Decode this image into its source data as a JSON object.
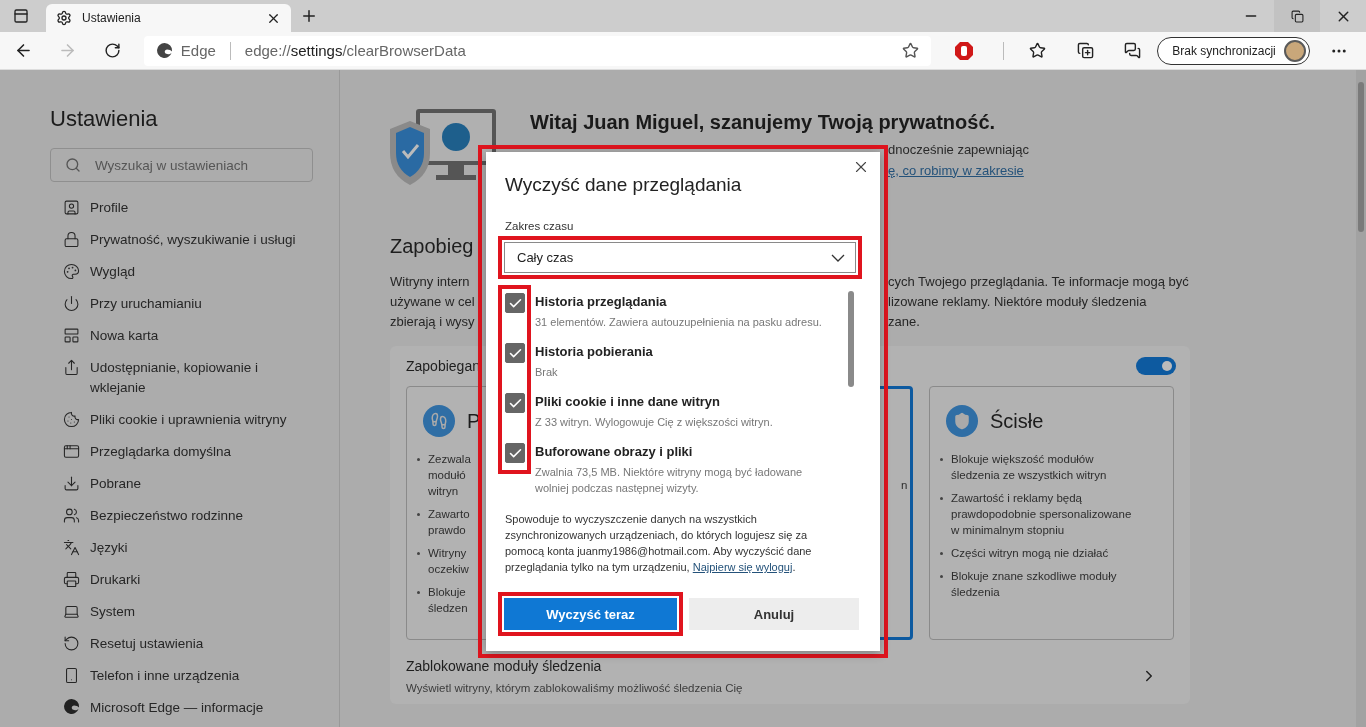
{
  "tabs": [
    {
      "label": "Ustawienia",
      "selected": true
    }
  ],
  "address_bar": {
    "site_label": "Edge",
    "url_prefix": "edge://",
    "url_host": "settings",
    "url_path": "/clearBrowserData"
  },
  "sync_button": {
    "label": "Brak synchronizacji"
  },
  "sidebar": {
    "title": "Ustawienia",
    "search": {
      "placeholder": "Wyszukaj w ustawieniach"
    },
    "items": [
      {
        "label": "Profile"
      },
      {
        "label": "Prywatność, wyszukiwanie i usługi"
      },
      {
        "label": "Wygląd"
      },
      {
        "label": "Przy uruchamianiu"
      },
      {
        "label": "Nowa karta"
      },
      {
        "label": "Udostępnianie, kopiowanie i wklejanie"
      },
      {
        "label": "Pliki cookie i uprawnienia witryny"
      },
      {
        "label": "Przeglądarka domyślna"
      },
      {
        "label": "Pobrane"
      },
      {
        "label": "Bezpieczeństwo rodzinne"
      },
      {
        "label": "Języki"
      },
      {
        "label": "Drukarki"
      },
      {
        "label": "System"
      },
      {
        "label": "Resetuj ustawienia"
      },
      {
        "label": "Telefon i inne urządzenia"
      },
      {
        "label": "Microsoft Edge — informacje"
      }
    ]
  },
  "privacy_header": {
    "title": "Witaj Juan Miguel, szanujemy Twoją prywatność.",
    "line_2": "dnocześnie zapewniając",
    "link": "ę, co robimy w zakresie"
  },
  "tracking_section": {
    "title": "Zapobieg",
    "text_left": [
      "Witryny intern",
      "używane w cel",
      "zbierają i wysy"
    ],
    "text_right": [
      "cych Twojego przeglądania. Te informacje mogą być",
      "lizowane reklamy. Niektóre moduły śledzenia",
      "zane."
    ],
    "card_title": "Zapobiegan",
    "toggle_on": true,
    "options": [
      {
        "title": "P",
        "selected": false,
        "bullets": [
          [
            "Zezwala",
            "modułó",
            "witryn"
          ],
          [
            "Zawarto",
            "prawdo"
          ],
          [
            "Witryny",
            "oczekiw"
          ],
          [
            "Blokuje",
            "śledzen"
          ]
        ]
      },
      {
        "selected": true,
        "bullets": [
          [
            "n"
          ]
        ]
      },
      {
        "title": "Ścisłe",
        "selected": false,
        "bullets": [
          [
            "Blokuje większość modułów",
            "śledzenia ze wszystkich witryn"
          ],
          [
            "Zawartość i reklamy będą",
            "prawdopodobnie spersonalizowane",
            "w minimalnym stopniu"
          ],
          [
            "Części witryn mogą nie działać"
          ],
          [
            "Blokuje znane szkodliwe moduły",
            "śledzenia"
          ]
        ]
      }
    ],
    "blocked": {
      "title": "Zablokowane moduły śledzenia",
      "subtitle": "Wyświetl witryny, którym zablokowaliśmy możliwość śledzenia Cię"
    }
  },
  "dialog": {
    "title": "Wyczyść dane przeglądania",
    "highlighted": true,
    "checkboxes_highlighted": true,
    "time_range": {
      "label": "Zakres czasu",
      "value": "Cały czas",
      "highlighted": true
    },
    "items": [
      {
        "label": "Historia przeglądania",
        "detail": "31 elementów. Zawiera autouzupełnienia na pasku adresu.",
        "checked": true
      },
      {
        "label": "Historia pobierania",
        "detail": "Brak",
        "checked": true
      },
      {
        "label": "Pliki cookie i inne dane witryn",
        "detail": "Z 33 witryn. Wylogowuje Cię z większości witryn.",
        "checked": true
      },
      {
        "label": "Buforowane obrazy i pliki",
        "detail": "Zwalnia 73,5 MB. Niektóre witryny mogą być ładowane wolniej podczas następnej wizyty.",
        "checked": true
      }
    ],
    "note": "Spowoduje to wyczyszczenie danych na wszystkich zsynchronizowanych urządzeniach, do których logujesz się za pomocą konta juanmy1986@hotmail.com. Aby wyczyścić dane przeglądania tylko na tym urządzeniu,",
    "note_link": "Najpierw się wyloguj",
    "note_end": ".",
    "buttons": [
      {
        "label": "Wyczyść teraz",
        "kind": "primary",
        "highlighted": true
      },
      {
        "label": "Anuluj",
        "kind": "secondary",
        "highlighted": false
      }
    ]
  }
}
